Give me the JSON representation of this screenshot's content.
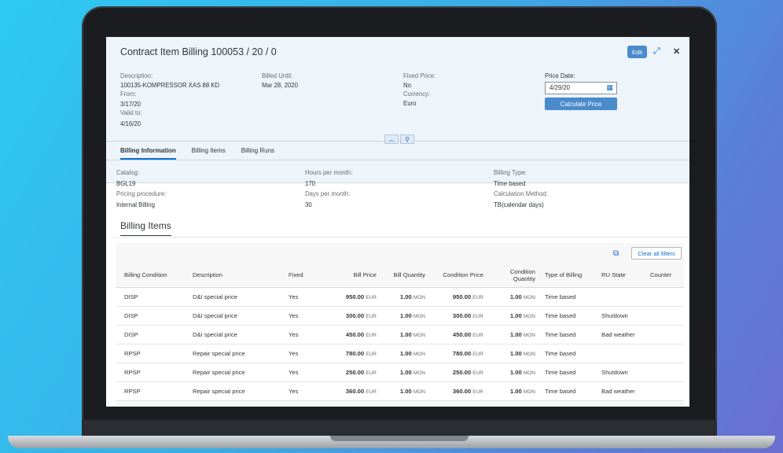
{
  "header": {
    "title": "Contract Item Billing 100053 / 20 / 0",
    "edit_label": "Edit",
    "description_label": "Description:",
    "description_value": "100135-KOMPRESSOR XAS 88 KD",
    "from_label": "From:",
    "from_value": "3/17/20",
    "valid_to_label": "Valid to:",
    "valid_to_value": "4/16/20",
    "billed_until_label": "Billed Until:",
    "billed_until_value": "Mar 28, 2020",
    "fixed_price_label": "Fixed Price:",
    "fixed_price_value": "No",
    "currency_label": "Currency:",
    "currency_value": "Euro",
    "price_date_label": "Price Date:",
    "price_date_value": "4/29/20",
    "calculate_label": "Calculate Price"
  },
  "tabs": [
    {
      "label": "Billing Information",
      "active": true
    },
    {
      "label": "Billing Items"
    },
    {
      "label": "Billing Runs"
    }
  ],
  "info": {
    "catalog_label": "Catalog:",
    "catalog_value": "BGL19",
    "pricing_label": "Pricing procedure:",
    "pricing_value": "Internal Billing",
    "hours_label": "Hours per month:",
    "hours_value": "170",
    "days_label": "Days per month:",
    "days_value": "30",
    "billing_type_label": "Billing Type:",
    "billing_type_value": "Time based",
    "calc_method_label": "Calculation Method:",
    "calc_method_value": "TB(calendar days)"
  },
  "billing_items": {
    "title": "Billing Items",
    "clear_filters_label": "Clear all filters",
    "columns": [
      "Billing Condition",
      "Description",
      "Fixed",
      "Bill Price",
      "Bill Quantity",
      "Condition Price",
      "Condition Quantity",
      "Type of Billing",
      "RU State",
      "Counter"
    ],
    "rows": [
      {
        "cond": "DISP",
        "desc": "D&I special price",
        "fixed": "Yes",
        "bill_price": "950.00",
        "bill_cur": "EUR",
        "bill_qty": "1.00",
        "bill_unit": "MON",
        "cond_price": "950.00",
        "cond_cur": "EUR",
        "cond_qty": "1.00",
        "cond_unit": "MON",
        "type": "Time based",
        "state": "",
        "counter": ""
      },
      {
        "cond": "DISP",
        "desc": "D&I special price",
        "fixed": "Yes",
        "bill_price": "300.00",
        "bill_cur": "EUR",
        "bill_qty": "1.00",
        "bill_unit": "MON",
        "cond_price": "300.00",
        "cond_cur": "EUR",
        "cond_qty": "1.00",
        "cond_unit": "MON",
        "type": "Time based",
        "state": "Shutdown",
        "counter": ""
      },
      {
        "cond": "DISP",
        "desc": "D&I special price",
        "fixed": "Yes",
        "bill_price": "450.00",
        "bill_cur": "EUR",
        "bill_qty": "1.00",
        "bill_unit": "MON",
        "cond_price": "450.00",
        "cond_cur": "EUR",
        "cond_qty": "1.00",
        "cond_unit": "MON",
        "type": "Time based",
        "state": "Bad weather",
        "counter": ""
      },
      {
        "cond": "RPSP",
        "desc": "Repair special price",
        "fixed": "Yes",
        "bill_price": "780.00",
        "bill_cur": "EUR",
        "bill_qty": "1.00",
        "bill_unit": "MON",
        "cond_price": "780.00",
        "cond_cur": "EUR",
        "cond_qty": "1.00",
        "cond_unit": "MON",
        "type": "Time based",
        "state": "",
        "counter": ""
      },
      {
        "cond": "RPSP",
        "desc": "Repair special price",
        "fixed": "Yes",
        "bill_price": "250.00",
        "bill_cur": "EUR",
        "bill_qty": "1.00",
        "bill_unit": "MON",
        "cond_price": "250.00",
        "cond_cur": "EUR",
        "cond_qty": "1.00",
        "cond_unit": "MON",
        "type": "Time based",
        "state": "Shutdown",
        "counter": ""
      },
      {
        "cond": "RPSP",
        "desc": "Repair special price",
        "fixed": "Yes",
        "bill_price": "360.00",
        "bill_cur": "EUR",
        "bill_qty": "1.00",
        "bill_unit": "MON",
        "cond_price": "360.00",
        "cond_cur": "EUR",
        "cond_qty": "1.00",
        "cond_unit": "MON",
        "type": "Time based",
        "state": "Bad weather",
        "counter": ""
      }
    ]
  },
  "colors": {
    "accent": "#0a6ed1",
    "button": "#4a8bcc",
    "header_bg": "#edf4fa"
  }
}
